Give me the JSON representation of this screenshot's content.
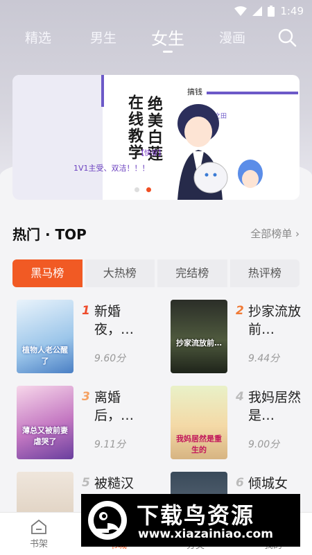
{
  "status_bar": {
    "time": "1:49"
  },
  "nav_tabs": [
    {
      "label": "精选"
    },
    {
      "label": "男生"
    },
    {
      "label": "女生",
      "active": true
    },
    {
      "label": "漫画"
    }
  ],
  "banner": {
    "title_col1": "在线教学",
    "title_col2": "绝美白莲",
    "tag": "【快穿】",
    "subtitle": "1V1主受、双洁！！！",
    "small_top": "搞钱",
    "small_right": "菜之田"
  },
  "section": {
    "title": "热门 · TOP",
    "more": "全部榜单"
  },
  "rank_tabs": [
    {
      "label": "黑马榜",
      "active": true
    },
    {
      "label": "大热榜"
    },
    {
      "label": "完结榜"
    },
    {
      "label": "热评榜"
    }
  ],
  "books": [
    {
      "rank": "1",
      "title": "新婚夜，…",
      "score": "9.60分",
      "cover_text": "植物人老公醒了"
    },
    {
      "rank": "2",
      "title": "抄家流放前…",
      "score": "9.44分",
      "cover_text": "抄家流放前…"
    },
    {
      "rank": "3",
      "title": "离婚后，…",
      "score": "9.11分",
      "cover_text": "薄总又被前妻虐哭了"
    },
    {
      "rank": "4",
      "title": "我妈居然是…",
      "score": "9.00分",
      "cover_text": "我妈居然是重生的"
    },
    {
      "rank": "5",
      "title": "被糙汉",
      "score": "",
      "cover_text": ""
    },
    {
      "rank": "6",
      "title": "倾城女",
      "score": "",
      "cover_text": ""
    }
  ],
  "bottom_nav": [
    {
      "label": "书架"
    },
    {
      "label": "书城"
    },
    {
      "label": "分类"
    },
    {
      "label": "我的"
    }
  ],
  "watermark": {
    "name": "下载鸟资源",
    "url": "www.xiazainiao.com"
  },
  "colors": {
    "accent": "#f15a24",
    "banner_purple": "#6c59c8"
  }
}
